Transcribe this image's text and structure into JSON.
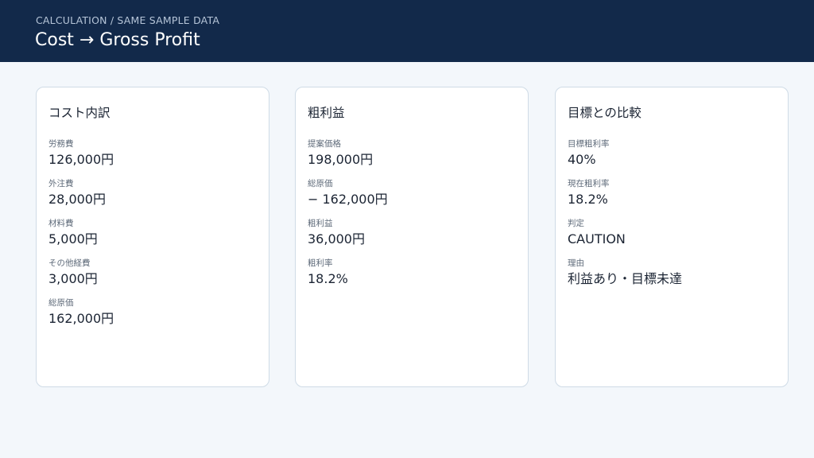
{
  "header": {
    "eyebrow": "CALCULATION / SAME SAMPLE DATA",
    "title": "Cost → Gross Profit"
  },
  "cards": [
    {
      "title": "コスト内訳",
      "fields": [
        {
          "label": "労務費",
          "value": "126,000円"
        },
        {
          "label": "外注費",
          "value": "28,000円"
        },
        {
          "label": "材料費",
          "value": "5,000円"
        },
        {
          "label": "その他経費",
          "value": "3,000円"
        },
        {
          "label": "総原価",
          "value": "162,000円"
        }
      ]
    },
    {
      "title": "粗利益",
      "fields": [
        {
          "label": "提案価格",
          "value": "198,000円"
        },
        {
          "label": "総原価",
          "value": "− 162,000円"
        },
        {
          "label": "粗利益",
          "value": "36,000円"
        },
        {
          "label": "粗利率",
          "value": "18.2%"
        }
      ]
    },
    {
      "title": "目標との比較",
      "fields": [
        {
          "label": "目標粗利率",
          "value": "40%"
        },
        {
          "label": "現在粗利率",
          "value": "18.2%"
        },
        {
          "label": "判定",
          "value": "CAUTION"
        },
        {
          "label": "理由",
          "value": "利益あり・目標未達"
        }
      ]
    }
  ]
}
